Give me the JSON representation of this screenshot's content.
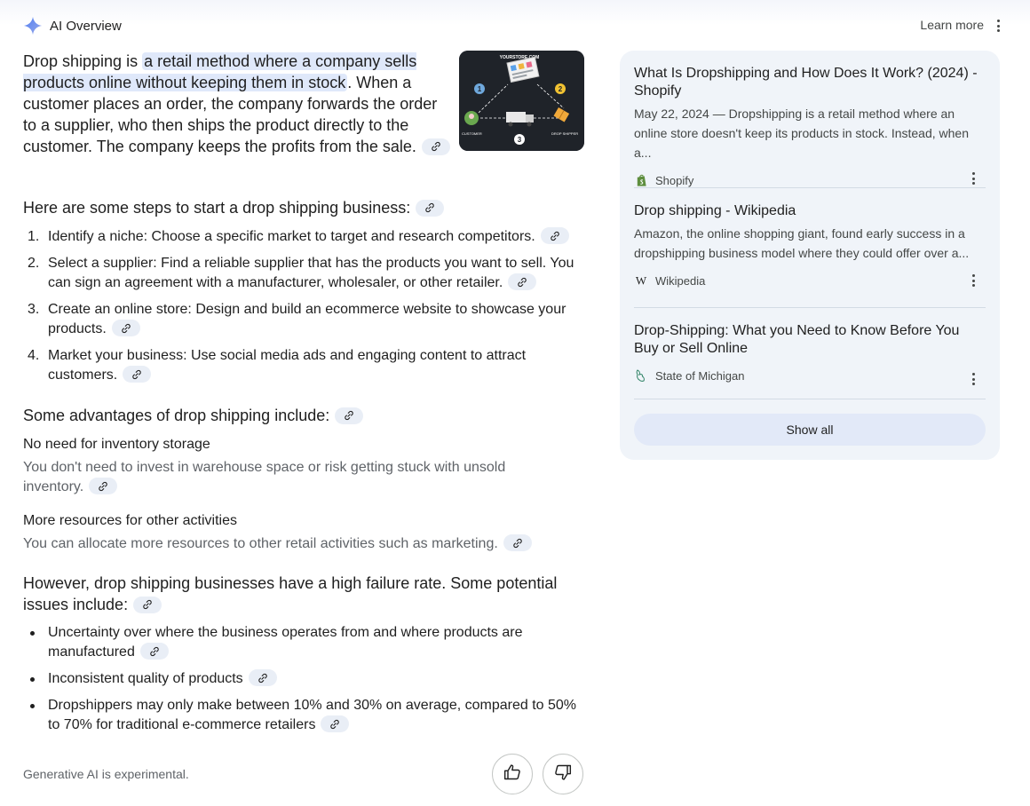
{
  "header": {
    "title": "AI Overview",
    "learn_more": "Learn more",
    "spark_icon": "sparkle-icon",
    "more_icon": "more-vert-icon"
  },
  "intro": {
    "lead": "Drop shipping is ",
    "highlight": "a retail method where a company sells products online without keeping them in stock",
    "rest": ". When a customer places an order, the company forwards the order to a supplier, who then ships the product directly to the customer. The company keeps the profits from the sale.",
    "image": {
      "store_label": "YOURSTORE.COM",
      "customer_label": "CUSTOMER",
      "shipper_label": "DROP SHIPPER",
      "step1": "1",
      "step2": "2",
      "step3": "3"
    }
  },
  "steps": {
    "heading": "Here are some steps to start a drop shipping business:",
    "items": [
      {
        "num": "1.",
        "text": "Identify a niche: Choose a specific market to target and research competitors."
      },
      {
        "num": "2.",
        "text": "Select a supplier: Find a reliable supplier that has the products you want to sell. You can sign an agreement with a manufacturer, wholesaler, or other retailer."
      },
      {
        "num": "3.",
        "text": "Create an online store: Design and build an ecommerce website to showcase your products."
      },
      {
        "num": "4.",
        "text": "Market your business: Use social media ads and engaging content to attract customers."
      }
    ]
  },
  "advantages": {
    "heading": "Some advantages of drop shipping include:",
    "items": [
      {
        "title": "No need for inventory storage",
        "text": "You don't need to invest in warehouse space or risk getting stuck with unsold inventory."
      },
      {
        "title": "More resources for other activities",
        "text": "You can allocate more resources to other retail activities such as marketing."
      }
    ]
  },
  "issues": {
    "heading": "However, drop shipping businesses have a high failure rate. Some potential issues include:",
    "items": [
      "Uncertainty over where the business operates from and where products are manufactured",
      "Inconsistent quality of products",
      "Dropshippers may only make between 10% and 30% on average, compared to 50% to 70% for traditional e-commerce retailers"
    ]
  },
  "footer": {
    "note": "Generative AI is experimental.",
    "thumbs_up_icon": "thumbs-up-icon",
    "thumbs_down_icon": "thumbs-down-icon"
  },
  "sources": {
    "items": [
      {
        "title": "What Is Dropshipping and How Does It Work? (2024) - Shopify",
        "snippet": "May 22, 2024 — Dropshipping is a retail method where an online store doesn't keep its products in stock. Instead, when a...",
        "site": "Shopify",
        "favicon": "shopify-icon"
      },
      {
        "title": "Drop shipping - Wikipedia",
        "snippet": "Amazon, the online shopping giant, found early success in a dropshipping business model where they could offer over a...",
        "site": "Wikipedia",
        "favicon": "wikipedia-icon"
      },
      {
        "title": "Drop-Shipping: What you Need to Know Before You Buy or Sell Online",
        "snippet": "",
        "site": "State of Michigan",
        "favicon": "michigan-icon"
      }
    ],
    "show_all": "Show all"
  },
  "colors": {
    "highlight": "#dfe8fa",
    "chip": "#e9eef6",
    "panel": "#f0f4f9",
    "show_all_bg": "#e2e9f8",
    "shopify_green": "#5e8e3e"
  }
}
